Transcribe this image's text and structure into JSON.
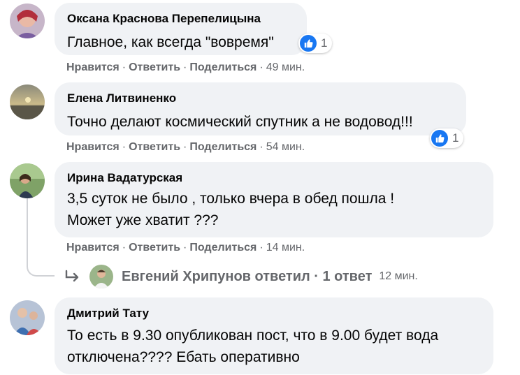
{
  "actions": {
    "like": "Нравится",
    "reply": "Ответить",
    "share": "Поделиться",
    "separator": "·"
  },
  "comments": [
    {
      "author": "Оксана Краснова Перепелицына",
      "lines": [
        "Главное, как всегда \"вовремя\""
      ],
      "time": "49 мин.",
      "reactions": {
        "icon": "like-icon",
        "count": "1"
      }
    },
    {
      "author": "Елена Литвиненко",
      "lines": [
        "Точно делают космический спутник а не водовод!!!"
      ],
      "time": "54 мин.",
      "reactions": {
        "icon": "like-icon",
        "count": "1"
      }
    },
    {
      "author": "Ирина Вадатурская",
      "lines": [
        "3,5 суток не было , только вчера в обед пошла !",
        "Может уже хватит ???"
      ],
      "time": "14 мин."
    },
    {
      "author": "Дмитрий Тату",
      "lines": [
        "То есть в 9.30 опубликован пост, что в 9.00 будет вода",
        "отключена???? Ебать оперативно"
      ]
    }
  ],
  "reply_preview": {
    "text": "Евгений Хрипунов ответил · 1 ответ",
    "time": "12 мин.",
    "icon": "reply-arrow-icon"
  },
  "colors": {
    "bubble": "#f0f2f5",
    "like": "#1877f2",
    "secondary_text": "#65676b"
  }
}
